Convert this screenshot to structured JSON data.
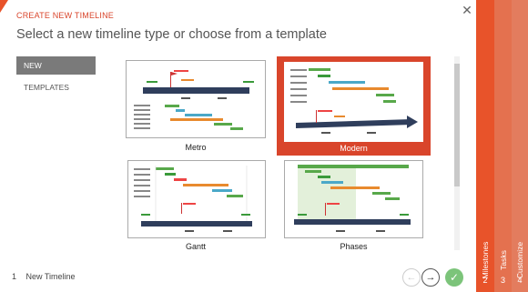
{
  "header": {
    "title": "CREATE NEW TIMELINE",
    "subtitle": "Select a new timeline type or choose from a template",
    "close_icon": "close-icon"
  },
  "nav": {
    "items": [
      {
        "label": "NEW",
        "active": true
      },
      {
        "label": "TEMPLATES",
        "active": false
      }
    ]
  },
  "gallery": {
    "tiles": [
      {
        "label": "Metro",
        "selected": false
      },
      {
        "label": "Modern",
        "selected": true
      },
      {
        "label": "Gantt",
        "selected": false
      },
      {
        "label": "Phases",
        "selected": false
      }
    ]
  },
  "footer": {
    "step_number": "1",
    "step_label": "New Timeline",
    "back_icon": "arrow-left-icon",
    "next_icon": "arrow-right-icon",
    "done_icon": "check-icon"
  },
  "steps": [
    {
      "label": "Milestones",
      "number": "2"
    },
    {
      "label": "Tasks",
      "number": "3"
    },
    {
      "label": "Customize",
      "number": "4"
    }
  ],
  "colors": {
    "accent": "#d9452b",
    "nav_active": "#7a7a7a",
    "done": "#7cc47a",
    "rail1": "#e8532a",
    "rail2": "#e4714f",
    "rail3": "#e37c5e"
  }
}
